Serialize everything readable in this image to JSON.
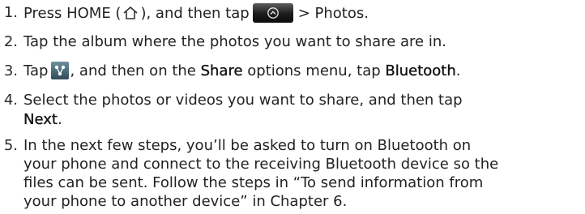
{
  "steps": [
    {
      "number": "1.",
      "lines": [
        {
          "pre": "Press HOME (",
          "post": "), and then tap",
          "after_button": "> Photos."
        }
      ]
    },
    {
      "number": "2.",
      "lines": [
        {
          "text": "Tap the album where the photos you want to share are in."
        }
      ]
    },
    {
      "number": "3.",
      "lines": [
        {
          "pre": "Tap",
          "mid": ", and then on the ",
          "bold1": "Share",
          "mid2": " options menu, tap ",
          "bold2": "Bluetooth",
          "post": "."
        }
      ]
    },
    {
      "number": "4.",
      "lines": [
        {
          "text": "Select the photos or videos you want to share, and then tap"
        },
        {
          "bold": "Next",
          "post": "."
        }
      ]
    },
    {
      "number": "5.",
      "lines": [
        {
          "text": "In the next few steps, you’ll be asked to turn on Bluetooth on"
        },
        {
          "text": "your phone and connect to the receiving Bluetooth device so the"
        },
        {
          "text": "files can be sent. Follow the steps in “To send information from"
        },
        {
          "text": "your phone to another device” in Chapter 6."
        }
      ]
    }
  ],
  "icons": {
    "home": "home-icon",
    "launcher": "all-apps-button",
    "share": "share-icon"
  }
}
